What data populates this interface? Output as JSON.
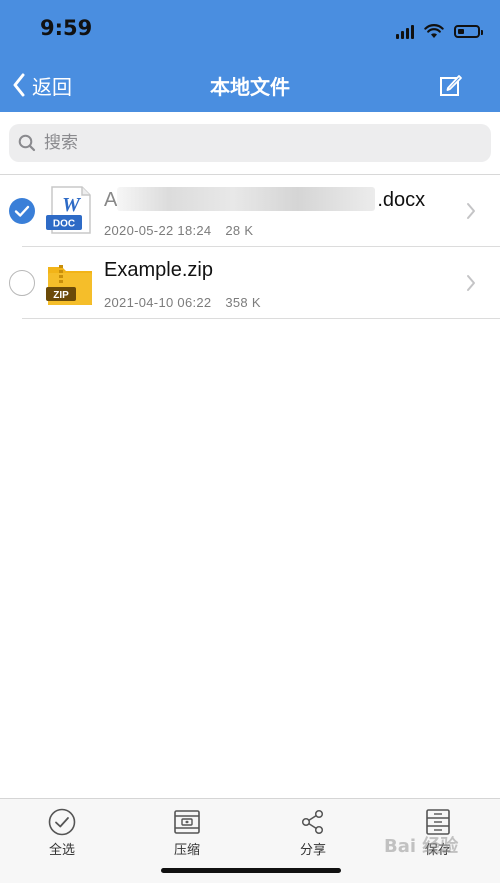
{
  "status_bar": {
    "time": "9:59"
  },
  "nav": {
    "back_label": "返回",
    "title": "本地文件"
  },
  "search": {
    "placeholder": "搜索",
    "value": ""
  },
  "files": [
    {
      "name_suffix": ".docx",
      "name_prefix": "A",
      "date": "2020-05-22 18:24",
      "size": "28 K",
      "icon_label": "DOC",
      "icon_letter": "W",
      "selected": true
    },
    {
      "name": "Example.zip",
      "date": "2021-04-10 06:22",
      "size": "358 K",
      "icon_label": "ZIP",
      "selected": false
    }
  ],
  "toolbar": {
    "select_all": "全选",
    "compress": "压缩",
    "share": "分享",
    "save": "保存"
  },
  "watermark": "Bai 经验",
  "colors": {
    "header": "#4a8ee0",
    "accent": "#3a7fd8",
    "doc_icon": "#2e6bc6",
    "zip_icon": "#f2b418"
  }
}
